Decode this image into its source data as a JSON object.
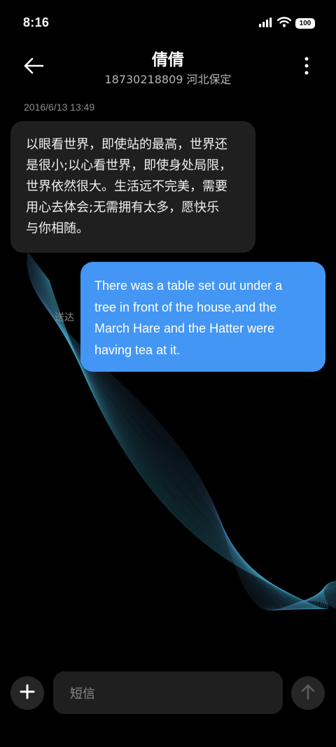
{
  "status_bar": {
    "time": "8:16",
    "battery": "100",
    "icons": [
      "signal-icon",
      "wifi-icon",
      "battery-icon"
    ]
  },
  "header": {
    "contact_name": "倩倩",
    "contact_detail": "18730218809 河北保定",
    "icons": [
      "back-arrow-icon",
      "more-vertical-icon"
    ]
  },
  "conversation": {
    "timestamp": "2016/6/13 13:49",
    "incoming": {
      "lines": [
        "以眼看世界，即使站的最高，世界还",
        "是很小;以心看世界，即使身处局限，",
        "世界依然很大。生活远不完美，需要",
        "用心去体会;无需拥有太多，愿快乐",
        "与你相随。"
      ]
    },
    "outgoing": {
      "status": "送达",
      "lines": [
        "There was a table set out under a",
        "tree in front of the house,and the",
        "March Hare and the Hatter were",
        "having tea at it."
      ]
    }
  },
  "composer": {
    "placeholder": "短信",
    "icons": [
      "plus-icon",
      "send-arrow-icon"
    ]
  },
  "colors": {
    "background": "#000000",
    "incoming_bubble": "#222222",
    "outgoing_bubble": "#4396f4",
    "secondary_text": "#8c8c8c"
  }
}
